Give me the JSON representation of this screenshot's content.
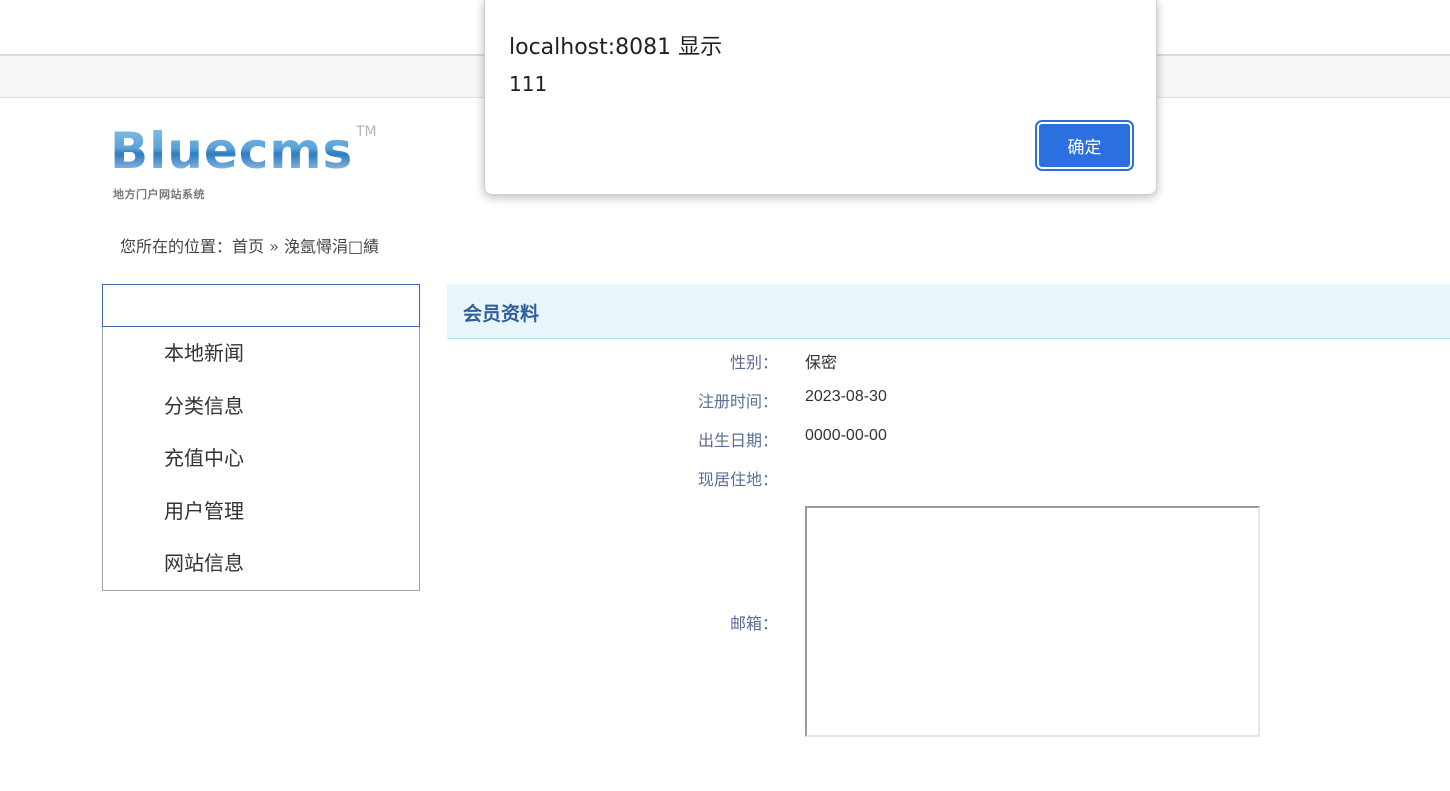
{
  "dialog": {
    "origin": "localhost:8081 显示",
    "message": "111",
    "ok_label": "确定"
  },
  "logo": {
    "wordmark": "Bluecms",
    "tm": "TM",
    "tagline": "地方门户网站系统"
  },
  "breadcrumb": {
    "prefix": "您所在的位置：",
    "home": "首页",
    "separator": "»",
    "current": "浼氬憳涓□績"
  },
  "sidebar": {
    "items": [
      {
        "label": "本地新闻"
      },
      {
        "label": "分类信息"
      },
      {
        "label": "充值中心"
      },
      {
        "label": "用户管理"
      },
      {
        "label": "网站信息"
      }
    ]
  },
  "main": {
    "title": "会员资料",
    "fields": {
      "gender": {
        "label": "性别：",
        "value": "保密"
      },
      "reg_time": {
        "label": "注册时间：",
        "value": "2023-08-30"
      },
      "birthday": {
        "label": "出生日期：",
        "value": "0000-00-00"
      },
      "address": {
        "label": "现居住地：",
        "value": ""
      },
      "email": {
        "label": "邮箱：",
        "value": ""
      }
    }
  },
  "colors": {
    "accent_blue": "#2b6fe0",
    "header_bg": "#e8f6fc",
    "title_blue": "#2f5f9c"
  }
}
